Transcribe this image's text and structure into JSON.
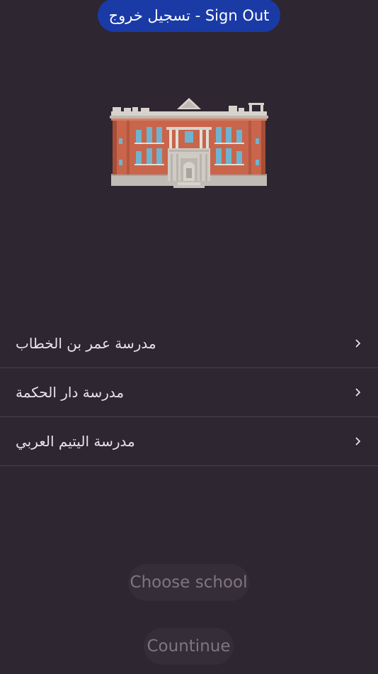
{
  "header": {
    "signout_label": "تسجيل خروج - Sign Out"
  },
  "illustration": {
    "icon": "school-building-icon"
  },
  "schools": [
    {
      "name": "مدرسة عمر بن الخطاب"
    },
    {
      "name": "مدرسة دار الحكمة"
    },
    {
      "name": "مدرسة اليتيم العربي"
    }
  ],
  "actions": {
    "choose_label": "Choose school",
    "continue_label": "Countinue"
  },
  "colors": {
    "background": "#2e2630",
    "signout_button": "#1a3aa6",
    "disabled_button_bg": "#352d37",
    "disabled_text": "#7e7680",
    "divider": "#4a424c"
  }
}
